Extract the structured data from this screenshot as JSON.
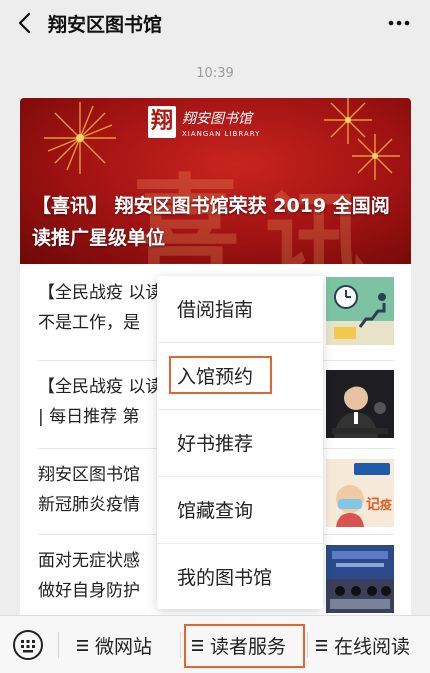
{
  "header": {
    "title": "翔安区图书馆"
  },
  "chat": {
    "time": "10:39"
  },
  "hero": {
    "title": "【喜讯】 翔安区图书馆荣获 2019 全国阅读推广星级单位",
    "logo_text": "翔安图书馆",
    "logo_sub": "XIANGAN LIBRARY"
  },
  "articles": [
    {
      "text": "【全民战疫 以读\n不是工作，是"
    },
    {
      "text": "【全民战疫 以读\n| 每日推荐 第"
    },
    {
      "text": "翔安区图书馆\n新冠肺炎疫情"
    },
    {
      "text": "面对无症状感\n做好自身防护"
    }
  ],
  "menu": {
    "items": [
      "借阅指南",
      "入馆预约",
      "好书推荐",
      "馆藏查询",
      "我的图书馆"
    ]
  },
  "bottom": {
    "tabs": [
      "微网站",
      "读者服务",
      "在线阅读"
    ]
  }
}
